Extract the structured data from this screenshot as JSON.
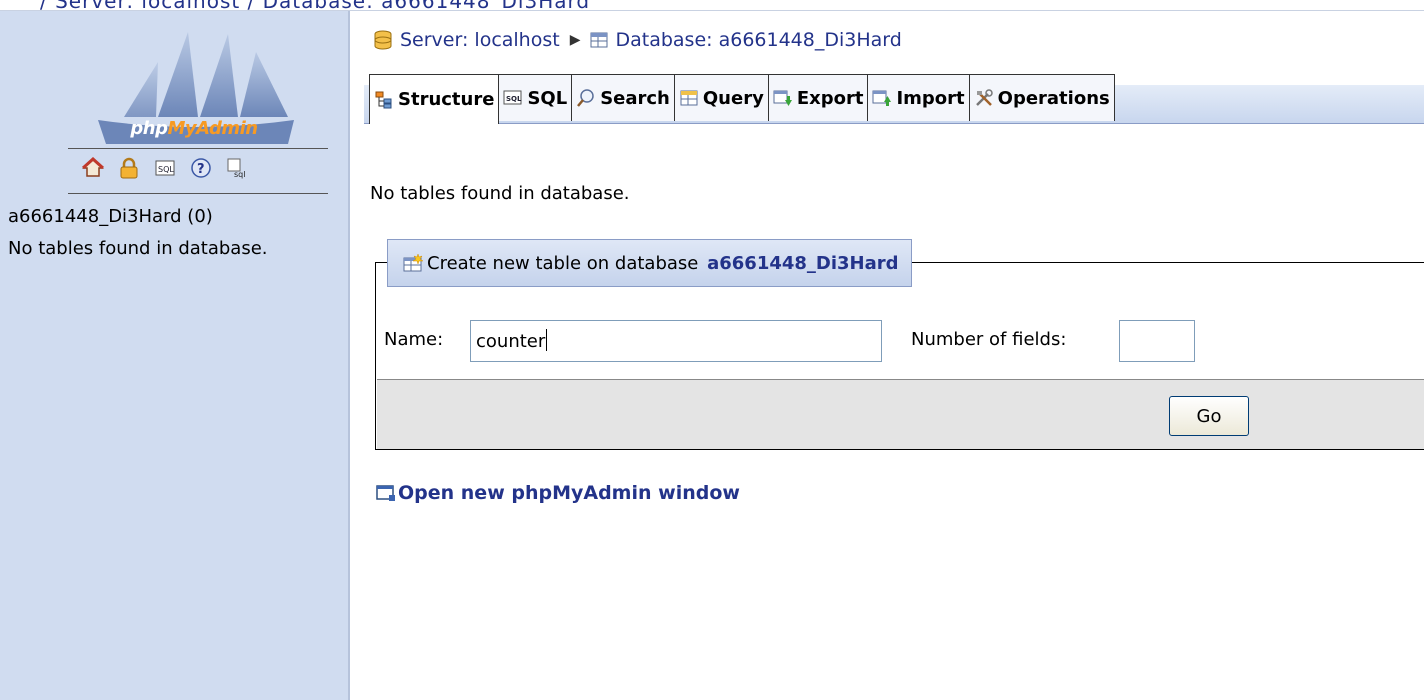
{
  "top": {
    "clipped_text": "/ Server: localhost / Database: a6661448_Di3Hard"
  },
  "sidebar": {
    "logo": {
      "text_php": "php",
      "text_myadmin": "MyAdmin"
    },
    "icons": [
      "home-icon",
      "lock-icon",
      "sql-query-icon",
      "help-icon",
      "sql-docs-icon"
    ],
    "db_link": "a6661448_Di3Hard (0)",
    "no_tables": "No tables found in database."
  },
  "breadcrumb": {
    "server": "Server: localhost",
    "database": "Database: a6661448_Di3Hard"
  },
  "tabs": [
    {
      "label": "Structure",
      "icon": "structure-icon",
      "active": true
    },
    {
      "label": "SQL",
      "icon": "sql-icon",
      "active": false
    },
    {
      "label": "Search",
      "icon": "search-icon",
      "active": false
    },
    {
      "label": "Query",
      "icon": "query-icon",
      "active": false
    },
    {
      "label": "Export",
      "icon": "export-icon",
      "active": false
    },
    {
      "label": "Import",
      "icon": "import-icon",
      "active": false
    },
    {
      "label": "Operations",
      "icon": "operations-icon",
      "active": false
    }
  ],
  "main": {
    "no_tables_msg": "No tables found in database.",
    "create": {
      "legend_prefix": "Create new table on database ",
      "legend_db": "a6661448_Di3Hard",
      "name_label": "Name:",
      "name_value": "counter",
      "fields_label": "Number of fields:",
      "fields_value": "",
      "go_label": "Go"
    },
    "open_window": "Open new phpMyAdmin window"
  },
  "colors": {
    "link": "#23338a",
    "sidebar_bg": "#d0dcf0",
    "accent": "#f79a23"
  }
}
